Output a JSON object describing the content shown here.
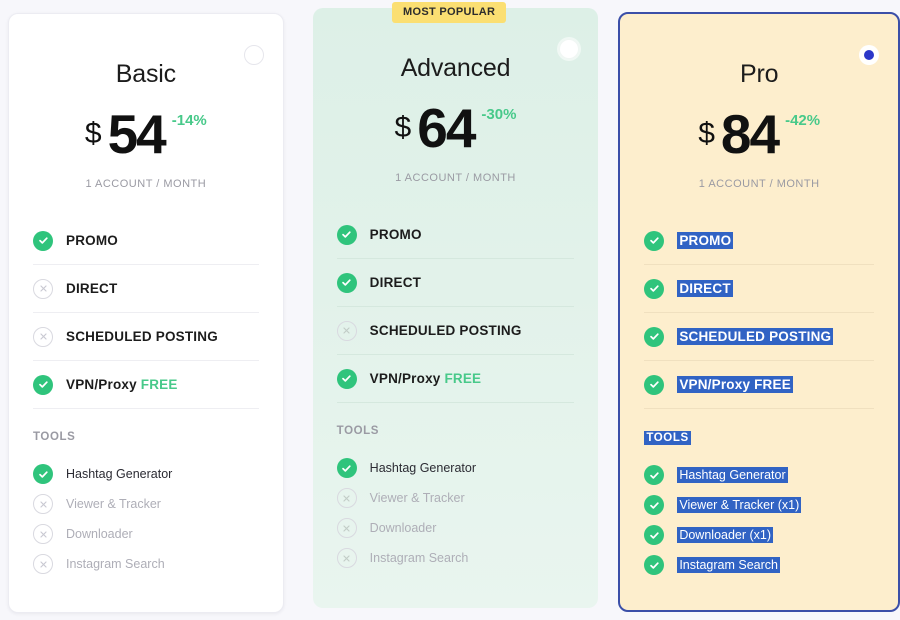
{
  "page": {
    "background": "#f7f7fb",
    "accent_green": "#2fc47c",
    "accent_blue": "#2b37c9",
    "selection_blue": "#3163c4",
    "badge_yellow": "#fbdf72"
  },
  "badge": {
    "most_popular_label": "MOST POPULAR"
  },
  "plans": [
    {
      "id": "basic",
      "name": "Basic",
      "currency": "$",
      "price": "54",
      "discount": "-14%",
      "period": "1 ACCOUNT / MONTH",
      "selected": false,
      "radio_icon": "radio-unchecked-icon",
      "features": [
        {
          "label": "PROMO",
          "enabled": true,
          "icon": "check-circle-icon"
        },
        {
          "label": "DIRECT",
          "enabled": false,
          "icon": "x-circle-icon"
        },
        {
          "label": "SCHEDULED POSTING",
          "enabled": false,
          "icon": "x-circle-icon"
        },
        {
          "label": "VPN/Proxy ",
          "suffix": "FREE",
          "enabled": true,
          "icon": "check-circle-icon"
        }
      ],
      "tools_title": "TOOLS",
      "tools": [
        {
          "label": "Hashtag Generator",
          "enabled": true,
          "icon": "check-circle-icon"
        },
        {
          "label": "Viewer & Tracker",
          "enabled": false,
          "icon": "x-circle-icon"
        },
        {
          "label": "Downloader",
          "enabled": false,
          "icon": "x-circle-icon"
        },
        {
          "label": "Instagram Search",
          "enabled": false,
          "icon": "x-circle-icon"
        }
      ]
    },
    {
      "id": "advanced",
      "name": "Advanced",
      "currency": "$",
      "price": "64",
      "discount": "-30%",
      "period": "1 ACCOUNT / MONTH",
      "selected": false,
      "radio_icon": "radio-unchecked-icon",
      "features": [
        {
          "label": "PROMO",
          "enabled": true,
          "icon": "check-circle-icon"
        },
        {
          "label": "DIRECT",
          "enabled": true,
          "icon": "check-circle-icon"
        },
        {
          "label": "SCHEDULED POSTING",
          "enabled": false,
          "icon": "x-circle-icon"
        },
        {
          "label": "VPN/Proxy ",
          "suffix": "FREE",
          "enabled": true,
          "icon": "check-circle-icon"
        }
      ],
      "tools_title": "TOOLS",
      "tools": [
        {
          "label": "Hashtag Generator",
          "enabled": true,
          "icon": "check-circle-icon"
        },
        {
          "label": "Viewer & Tracker",
          "enabled": false,
          "icon": "x-circle-icon"
        },
        {
          "label": "Downloader",
          "enabled": false,
          "icon": "x-circle-icon"
        },
        {
          "label": "Instagram Search",
          "enabled": false,
          "icon": "x-circle-icon"
        }
      ]
    },
    {
      "id": "pro",
      "name": "Pro",
      "currency": "$",
      "price": "84",
      "discount": "-42%",
      "period": "1 ACCOUNT / MONTH",
      "selected": true,
      "radio_icon": "radio-checked-icon",
      "text_selected": true,
      "features": [
        {
          "label": "PROMO",
          "enabled": true,
          "icon": "check-circle-icon"
        },
        {
          "label": "DIRECT",
          "enabled": true,
          "icon": "check-circle-icon"
        },
        {
          "label": "SCHEDULED POSTING",
          "enabled": true,
          "icon": "check-circle-icon"
        },
        {
          "label": "VPN/Proxy FREE",
          "enabled": true,
          "icon": "check-circle-icon"
        }
      ],
      "tools_title": "TOOLS",
      "tools": [
        {
          "label": "Hashtag Generator",
          "enabled": true,
          "icon": "check-circle-icon"
        },
        {
          "label": "Viewer & Tracker (x1)",
          "enabled": true,
          "icon": "check-circle-icon"
        },
        {
          "label": "Downloader (x1)",
          "enabled": true,
          "icon": "check-circle-icon"
        },
        {
          "label": "Instagram Search",
          "enabled": true,
          "icon": "check-circle-icon"
        }
      ]
    }
  ]
}
